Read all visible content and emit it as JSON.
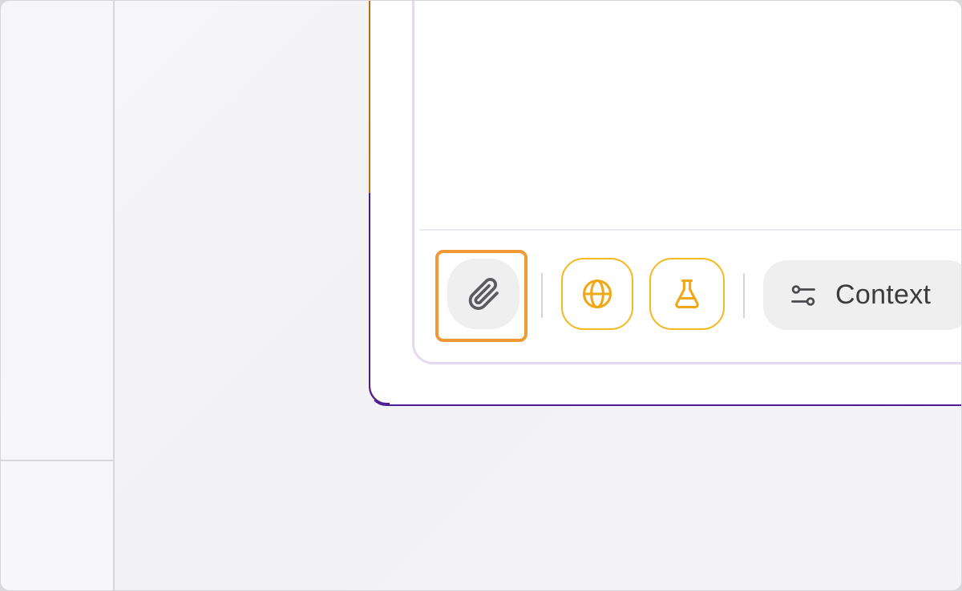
{
  "sidebar": {
    "icon": "none"
  },
  "composer": {
    "toolbar": {
      "attach": {
        "icon": "paperclip-icon",
        "highlighted": true
      },
      "web_search": {
        "icon": "globe-icon",
        "active": true
      },
      "research": {
        "icon": "flask-icon",
        "active": true
      },
      "context": {
        "icon": "sliders-icon",
        "label": "Context"
      }
    }
  },
  "colors": {
    "highlight": "#ef9a36",
    "active_toggle": "#f5b820",
    "panel_border": "#4b1d95",
    "composer_border": "#e6d9f2"
  }
}
